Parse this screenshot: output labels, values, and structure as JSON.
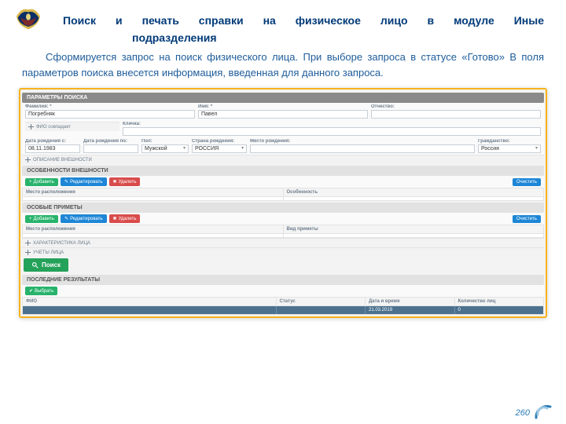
{
  "slide": {
    "title_line": "Поиск и печать справки на физическое лицо в модуле Иные",
    "title_sub": "подразделения",
    "body": "Сформируется запрос на поиск физического лица. При выборе запроса в статусе «Готово» В поля параметров поиска внесется информация, введенная для данного запроса.",
    "page_number": "260"
  },
  "panels": {
    "params": "ПАРАМЕТРЫ ПОИСКА",
    "appearance": "ОПИСАНИЕ ВНЕШНОСТИ",
    "features": "ОСОБЕННОСТИ ВНЕШНОСТИ",
    "marks": "ОСОБЫЕ ПРИМЕТЫ",
    "profile": "ХАРАКТЕРИСТИКА ЛИЦА",
    "records": "УЧЕТЫ ЛИЦА",
    "recent": "ПОСЛЕДНИЕ РЕЗУЛЬТАТЫ"
  },
  "labels": {
    "lastname": "Фамилия: *",
    "firstname": "Имя: *",
    "patronymic": "Отчество:",
    "alias": "Кличка:",
    "fio_combined": "ФИО совпадает",
    "dob_from": "Дата рождения с:",
    "dob_to": "Дата рождения по:",
    "sex": "Пол:",
    "birth_country": "Страна рождения:",
    "birth_place": "Место рождения:",
    "citizenship": "Гражданство:",
    "location": "Место расположения",
    "feature": "Особенность",
    "type": "Вид приметы"
  },
  "values": {
    "lastname": "Погребняк",
    "firstname": "Павел",
    "patronymic": "",
    "alias": "",
    "dob_from": "08.11.1983",
    "dob_to": "",
    "sex": "Мужской",
    "birth_country": "РОССИЯ",
    "citizenship": "Россия"
  },
  "buttons": {
    "add": "Добавить",
    "edit": "Редактировать",
    "delete": "Удалить",
    "clear": "Очистить",
    "search": "Поиск",
    "select": "Выбрать"
  },
  "table": {
    "cols": {
      "fio": "ФИО",
      "status": "Статус",
      "date": "Дата и время",
      "count": "Количество лиц"
    },
    "row": {
      "fio": "",
      "status": "",
      "date": "21.03.2019",
      "count": "0"
    }
  }
}
